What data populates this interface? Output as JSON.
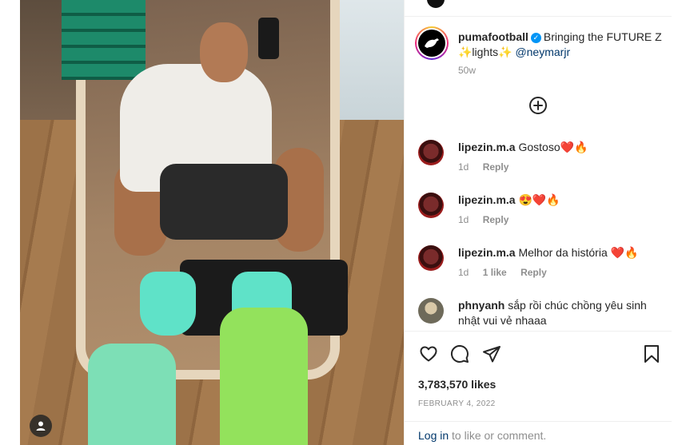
{
  "post": {
    "author": "pumafootball",
    "caption_text": "Bringing the FUTURE Z ✨lights✨",
    "caption_mention": "@neymarjr",
    "age": "50w",
    "likes": "3,783,570 likes",
    "date": "FEBRUARY 4, 2022"
  },
  "comments": [
    {
      "user": "lipezin.m.a",
      "text": "Gostoso❤️🔥",
      "age": "1d",
      "likes": "",
      "reply": "Reply"
    },
    {
      "user": "lipezin.m.a",
      "text": "😍❤️🔥",
      "age": "1d",
      "likes": "",
      "reply": "Reply"
    },
    {
      "user": "lipezin.m.a",
      "text": "Melhor da história ❤️🔥",
      "age": "1d",
      "likes": "1 like",
      "reply": "Reply"
    },
    {
      "user": "phnyanh",
      "text": "sắp rồi chúc chồng yêu sinh nhật vui vẻ nhaaa"
    }
  ],
  "footer": {
    "login_link": "Log in",
    "login_rest": "to like or comment."
  },
  "icons": {
    "verified": "verified-badge-icon",
    "load_more": "plus-circle-icon",
    "like": "heart-icon",
    "comment": "comment-bubble-icon",
    "share": "paper-plane-icon",
    "save": "bookmark-icon",
    "tags": "user-tag-icon"
  },
  "colors": {
    "link": "#00376b",
    "meta": "#8e8e8e",
    "verified": "#0095f6",
    "text": "#262626"
  }
}
